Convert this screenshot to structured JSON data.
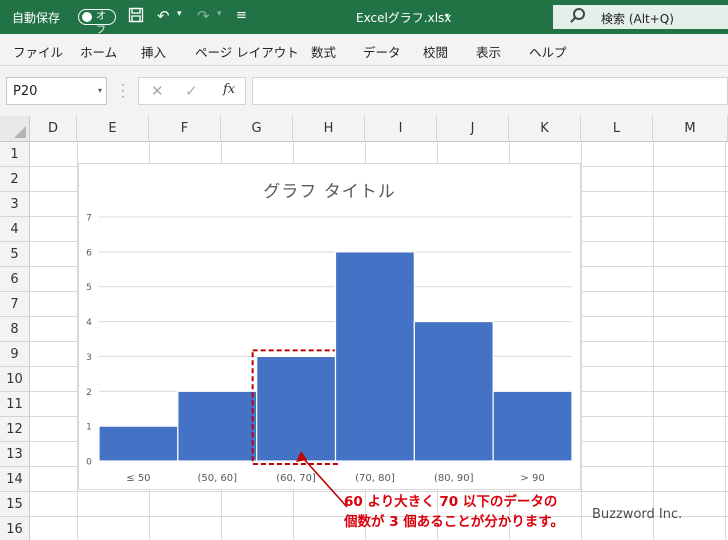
{
  "titlebar": {
    "autosave_label": "自動保存",
    "toggle_text": "オフ",
    "filename": "Excelグラフ.xlsx",
    "search_text": "検索 (Alt+Q)"
  },
  "menu": [
    "ファイル",
    "ホーム",
    "挿入",
    "ページ レイアウト",
    "数式",
    "データ",
    "校閲",
    "表示",
    "ヘルプ"
  ],
  "formula_bar": {
    "name_box": "P20",
    "fx_label": "fx",
    "formula": ""
  },
  "columns": [
    "D",
    "E",
    "F",
    "G",
    "H",
    "I",
    "J",
    "K",
    "L",
    "M"
  ],
  "rows": [
    "1",
    "2",
    "3",
    "4",
    "5",
    "6",
    "7",
    "8",
    "9",
    "10",
    "11",
    "12",
    "13",
    "14",
    "15",
    "16"
  ],
  "chart_data": {
    "type": "bar",
    "title": "グラフ タイトル",
    "categories": [
      "≤ 50",
      "(50, 60]",
      "(60, 70]",
      "(70, 80]",
      "(80, 90]",
      "> 90"
    ],
    "values": [
      1,
      2,
      3,
      6,
      4,
      2
    ],
    "ylim": [
      0,
      7
    ],
    "yticks": [
      "0",
      "1",
      "2",
      "3",
      "4",
      "5",
      "6",
      "7"
    ],
    "grid": true,
    "bar_color": "#4472c4",
    "highlight_category": "(60, 70]",
    "highlight_color": "#c00000"
  },
  "annotation": {
    "line1": "60 より大きく 70 以下のデータの",
    "line2": "個数が 3 個あることが分かります。",
    "color": "#d9000d"
  },
  "watermark": "Buzzword Inc.",
  "colors": {
    "excel_green": "#217346"
  }
}
